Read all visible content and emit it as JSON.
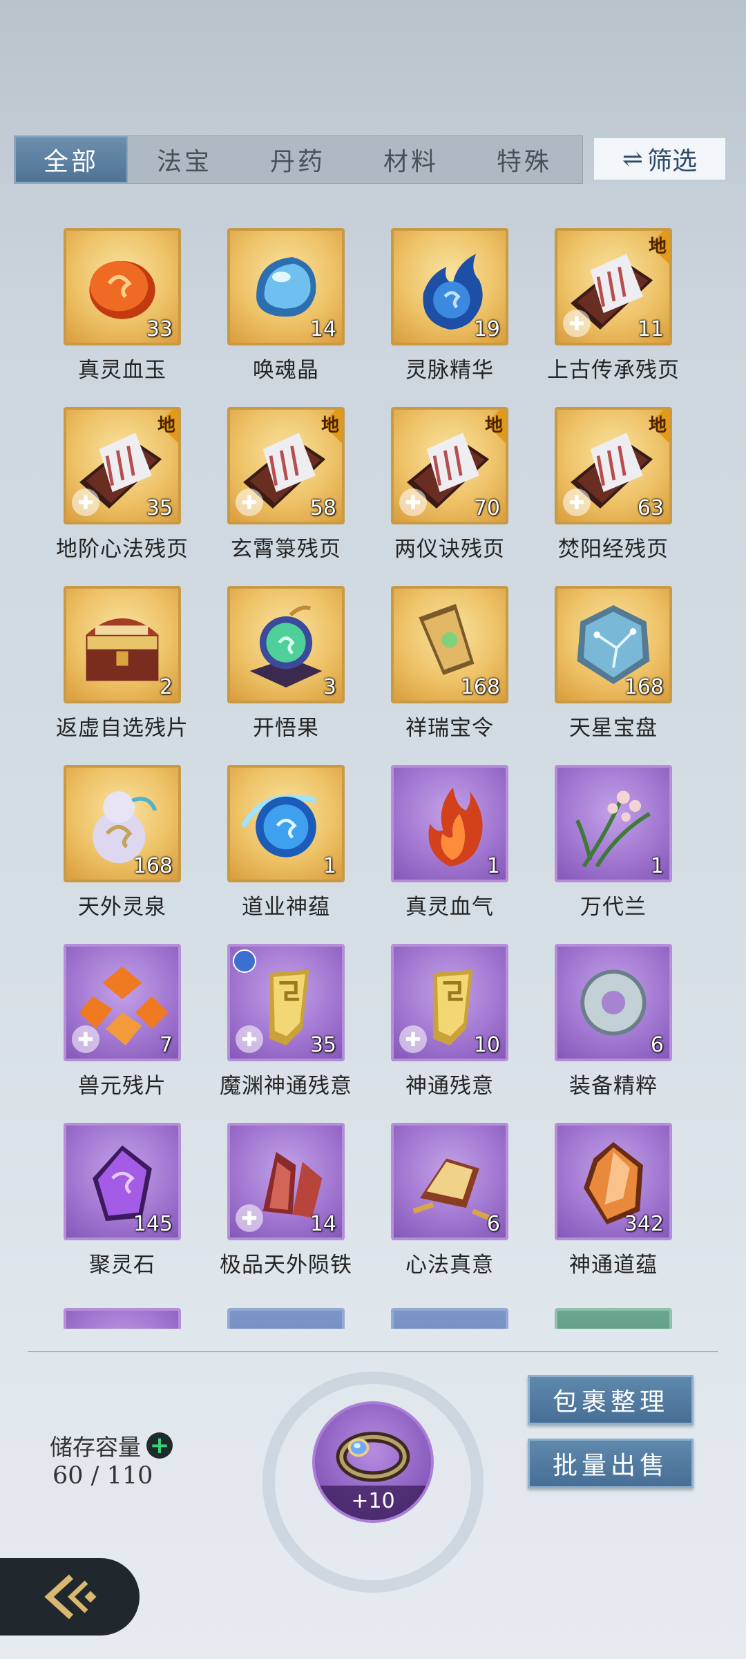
{
  "tabs": [
    {
      "label": "全部",
      "active": true
    },
    {
      "label": "法宝",
      "active": false
    },
    {
      "label": "丹药",
      "active": false
    },
    {
      "label": "材料",
      "active": false
    },
    {
      "label": "特殊",
      "active": false
    }
  ],
  "filter_label": "筛选",
  "items": [
    {
      "name": "真灵血玉",
      "count": "33",
      "rarity": "gold",
      "icon": "red-jade-icon"
    },
    {
      "name": "唤魂晶",
      "count": "14",
      "rarity": "gold",
      "icon": "blue-crystal-icon"
    },
    {
      "name": "灵脉精华",
      "count": "19",
      "rarity": "gold",
      "icon": "blue-flame-icon"
    },
    {
      "name": "上古传承残页",
      "count": "11",
      "rarity": "gold",
      "icon": "scroll-box-icon",
      "grade": "地",
      "piece": true
    },
    {
      "name": "地阶心法残页",
      "count": "35",
      "rarity": "gold",
      "icon": "scroll-box-icon",
      "grade": "地",
      "piece": true
    },
    {
      "name": "玄霄箓残页",
      "count": "58",
      "rarity": "gold",
      "icon": "scroll-box-icon",
      "grade": "地",
      "piece": true
    },
    {
      "name": "两仪诀残页",
      "count": "70",
      "rarity": "gold",
      "icon": "scroll-box-icon",
      "grade": "地",
      "piece": true
    },
    {
      "name": "焚阳经残页",
      "count": "63",
      "rarity": "gold",
      "icon": "scroll-box-icon",
      "grade": "地",
      "piece": true
    },
    {
      "name": "返虚自选残片",
      "count": "2",
      "rarity": "gold",
      "icon": "treasure-chest-icon"
    },
    {
      "name": "开悟果",
      "count": "3",
      "rarity": "gold",
      "icon": "glowing-fruit-icon"
    },
    {
      "name": "祥瑞宝令",
      "count": "168",
      "rarity": "gold",
      "icon": "token-icon"
    },
    {
      "name": "天星宝盘",
      "count": "168",
      "rarity": "gold",
      "icon": "star-plate-icon"
    },
    {
      "name": "天外灵泉",
      "count": "168",
      "rarity": "gold",
      "icon": "gourd-icon"
    },
    {
      "name": "道业神蕴",
      "count": "1",
      "rarity": "gold",
      "icon": "blue-orb-icon"
    },
    {
      "name": "真灵血气",
      "count": "1",
      "rarity": "purple",
      "icon": "red-flame-icon"
    },
    {
      "name": "万代兰",
      "count": "1",
      "rarity": "purple",
      "icon": "orchid-icon"
    },
    {
      "name": "兽元残片",
      "count": "7",
      "rarity": "purple",
      "icon": "orange-shards-icon",
      "piece": true
    },
    {
      "name": "魔渊神通残意",
      "count": "35",
      "rarity": "purple",
      "icon": "golden-tablet-icon",
      "piece": true,
      "badge": true
    },
    {
      "name": "神通残意",
      "count": "10",
      "rarity": "purple",
      "icon": "golden-tablet-icon",
      "piece": true
    },
    {
      "name": "装备精粹",
      "count": "6",
      "rarity": "purple",
      "icon": "jade-ring-icon"
    },
    {
      "name": "聚灵石",
      "count": "145",
      "rarity": "purple",
      "icon": "purple-crystal-icon"
    },
    {
      "name": "极品天外陨铁",
      "count": "14",
      "rarity": "purple",
      "icon": "red-ore-icon",
      "piece": true
    },
    {
      "name": "心法真意",
      "count": "6",
      "rarity": "purple",
      "icon": "golden-artifact-icon"
    },
    {
      "name": "神通道蕴",
      "count": "342",
      "rarity": "purple",
      "icon": "amber-crystal-icon"
    }
  ],
  "partial_row": [
    "purple",
    "blue",
    "blue",
    "green"
  ],
  "storage": {
    "label": "储存容量",
    "value": "60 / 110"
  },
  "center_item": {
    "plus": "+10",
    "icon": "ring-icon"
  },
  "buttons": {
    "organize": "包裹整理",
    "bulk_sell": "批量出售"
  },
  "colors": {
    "tab_active": "#4f7496",
    "gold_bg": "#eec267",
    "purple_bg": "#9f74cf",
    "button_bg": "#476f95"
  }
}
